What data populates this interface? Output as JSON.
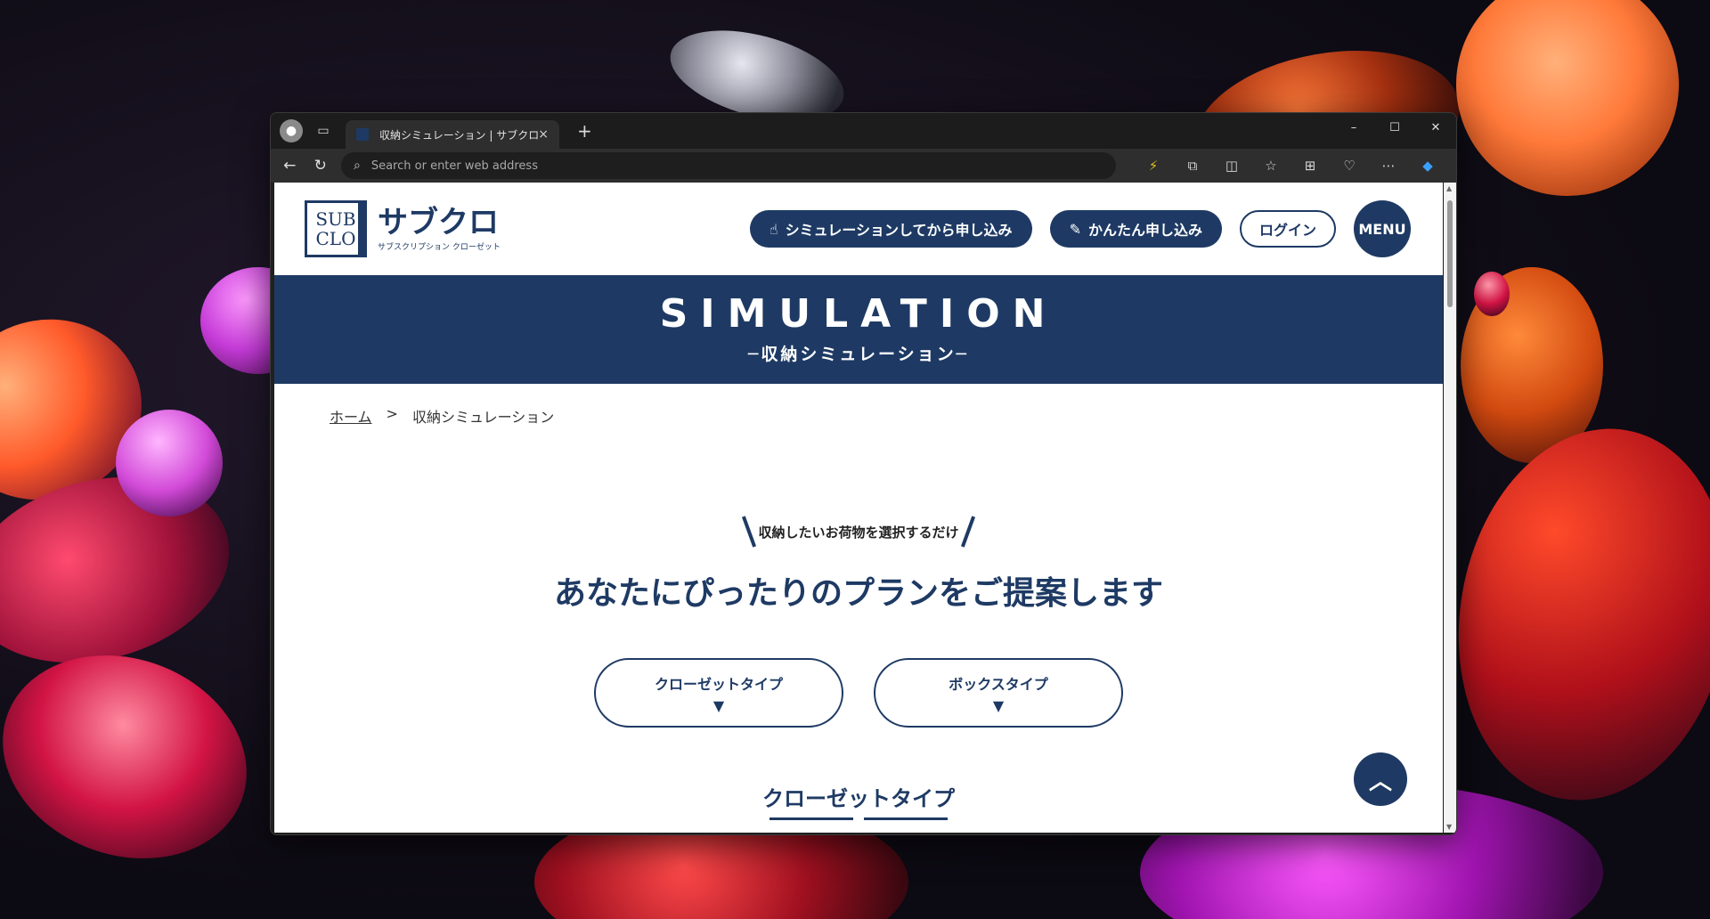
{
  "browser": {
    "tab_title": "収納シミュレーション | サブクロ",
    "tab_close": "×",
    "new_tab": "+",
    "address_placeholder": "Search or enter web address",
    "win_minimize": "–",
    "win_maximize": "☐",
    "win_close": "✕"
  },
  "site": {
    "logo_mark_top": "SUB",
    "logo_mark_bottom": "CLO",
    "logo_name": "サブクロ",
    "logo_sub": "サブスクリプション クローゼット",
    "nav": {
      "simulate_apply": "シミュレーションしてから申し込み",
      "easy_apply": "かんたん申し込み",
      "login": "ログイン",
      "menu": "MENU"
    },
    "hero": {
      "title": "SIMULATION",
      "subtitle": "─収納シミュレーション─"
    },
    "breadcrumb": {
      "home": "ホーム",
      "separator": ">",
      "current": "収納シミュレーション"
    },
    "intro": {
      "small": "収納したいお荷物を選択するだけ",
      "big": "あなたにぴったりのプランをご提案します"
    },
    "type_buttons": [
      {
        "label": "クローゼットタイプ",
        "arrow": "▼"
      },
      {
        "label": "ボックスタイプ",
        "arrow": "▼"
      }
    ],
    "section_heading": "クローゼットタイプ",
    "to_top": "︿"
  },
  "colors": {
    "brand_navy": "#1e3a64",
    "chrome_dark": "#202020"
  },
  "icons": [
    "profile-icon",
    "tabs-icon",
    "back-arrow-icon",
    "refresh-icon",
    "search-icon",
    "extension-icon",
    "split-screen-icon",
    "favorites-icon",
    "collections-icon",
    "browser-essentials-icon",
    "more-icon",
    "copilot-icon",
    "finger-tap-icon",
    "pen-icon",
    "chevron-up-icon"
  ]
}
